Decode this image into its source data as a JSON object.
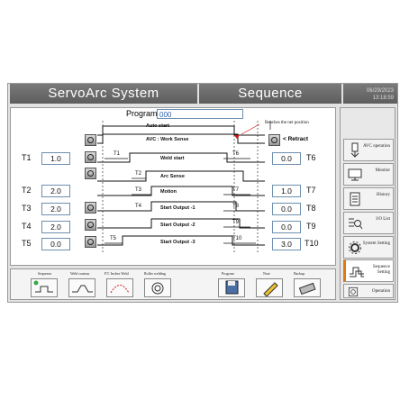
{
  "header": {
    "left_title": "ServoArc System",
    "right_title": "Sequence",
    "date": "06/29/2023",
    "time": "13:18:59"
  },
  "program": {
    "label": "Program :",
    "value": "000"
  },
  "timers_left": [
    {
      "label": "T1",
      "value": "1.0"
    },
    {
      "label": "T2",
      "value": "2.0"
    },
    {
      "label": "T3",
      "value": "2.0"
    },
    {
      "label": "T4",
      "value": "2.0"
    },
    {
      "label": "T5",
      "value": "0.0"
    }
  ],
  "timers_right": [
    {
      "label": "T6",
      "value": "0.0"
    },
    {
      "label": "T7",
      "value": "1.0"
    },
    {
      "label": "T8",
      "value": "0.0"
    },
    {
      "label": "T9",
      "value": "0.0"
    },
    {
      "label": "T10",
      "value": "3.0"
    }
  ],
  "signals": {
    "auto_start": "Auto start",
    "avc_work_sense": "AVC : Work Sense",
    "weld_start": "Weld start",
    "arc_sense": "Arc Sense",
    "motion": "Motion",
    "start_output_1": "Start Output -1",
    "start_output_2": "Start Output -2",
    "start_output_3": "Start Output -3"
  },
  "annotations": {
    "reaches_net_position": "Reaches the net position",
    "retract": "< Retract"
  },
  "seq_labels": [
    "T1",
    "T2",
    "T3",
    "T4",
    "T5",
    "T6",
    "T7",
    "T8",
    "T9",
    "T10"
  ],
  "sidebar": [
    {
      "label": "AVC operation",
      "icon": "torch-icon"
    },
    {
      "label": "Monitor",
      "icon": "monitor-icon"
    },
    {
      "label": "History",
      "icon": "document-icon"
    },
    {
      "label": "I/O List",
      "icon": "list-search-icon"
    },
    {
      "label": "System Setting",
      "icon": "gear-icon"
    },
    {
      "label": "Sequence Setting",
      "icon": "sequence-icon"
    },
    {
      "label": "Operation",
      "icon": "operation-icon"
    }
  ],
  "bottom": {
    "left_buttons": [
      "Sequence",
      "Weld contour",
      "P.T. Inches Weld",
      "Roller welding"
    ],
    "right_buttons": [
      "Program",
      "Note",
      "Backup"
    ]
  }
}
